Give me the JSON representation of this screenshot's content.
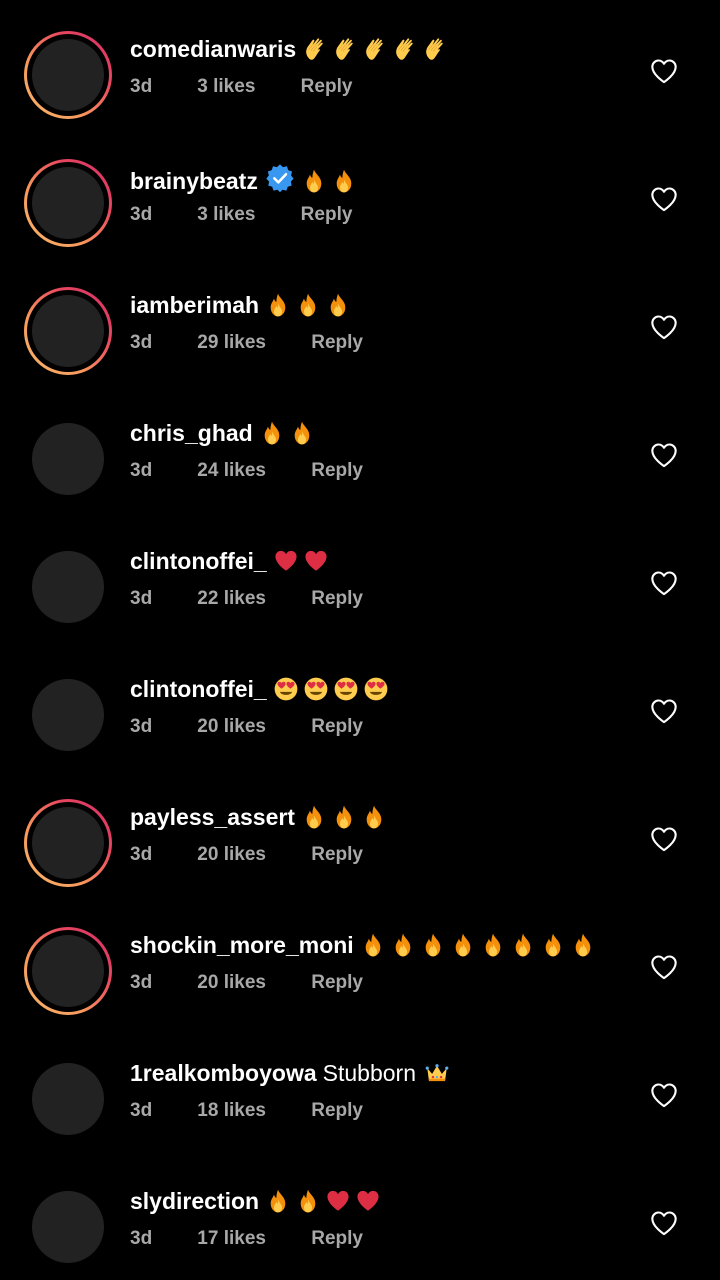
{
  "colors": {
    "background": "#000000",
    "meta_text": "#a8a8a8",
    "avatar_fill": "#222222",
    "verified_blue": "#3897f0",
    "story_ring": [
      "#f9b86a",
      "#e8475e",
      "#d42e6b"
    ]
  },
  "comments": [
    {
      "username": "comedianwaris",
      "verified": false,
      "story_ring": true,
      "text": "",
      "emojis": [
        "clap-emoji",
        "clap-emoji",
        "clap-emoji",
        "clap-emoji",
        "clap-emoji"
      ],
      "time": "3d",
      "likes": "3 likes",
      "reply": "Reply"
    },
    {
      "username": "brainybeatz",
      "verified": true,
      "story_ring": true,
      "text": "",
      "emojis": [
        "fire-emoji",
        "fire-emoji"
      ],
      "time": "3d",
      "likes": "3 likes",
      "reply": "Reply"
    },
    {
      "username": "iamberimah",
      "verified": false,
      "story_ring": true,
      "text": "",
      "emojis": [
        "fire-emoji",
        "fire-emoji",
        "fire-emoji"
      ],
      "time": "3d",
      "likes": "29 likes",
      "reply": "Reply"
    },
    {
      "username": "chris_ghad",
      "verified": false,
      "story_ring": false,
      "text": "",
      "emojis": [
        "fire-emoji",
        "fire-emoji"
      ],
      "time": "3d",
      "likes": "24 likes",
      "reply": "Reply"
    },
    {
      "username": "clintonoffei_",
      "verified": false,
      "story_ring": false,
      "text": "",
      "emojis": [
        "red-heart-emoji",
        "red-heart-emoji"
      ],
      "time": "3d",
      "likes": "22 likes",
      "reply": "Reply"
    },
    {
      "username": "clintonoffei_",
      "verified": false,
      "story_ring": false,
      "text": "",
      "emojis": [
        "heart-eyes-emoji",
        "heart-eyes-emoji",
        "heart-eyes-emoji",
        "heart-eyes-emoji"
      ],
      "time": "3d",
      "likes": "20 likes",
      "reply": "Reply"
    },
    {
      "username": "payless_assert",
      "verified": false,
      "story_ring": true,
      "text": "",
      "emojis": [
        "fire-emoji",
        "fire-emoji",
        "fire-emoji"
      ],
      "time": "3d",
      "likes": "20 likes",
      "reply": "Reply"
    },
    {
      "username": "shockin_more_moni",
      "verified": false,
      "story_ring": true,
      "text": "",
      "emojis": [
        "fire-emoji",
        "fire-emoji",
        "fire-emoji",
        "fire-emoji",
        "fire-emoji",
        "fire-emoji",
        "fire-emoji",
        "fire-emoji"
      ],
      "time": "3d",
      "likes": "20 likes",
      "reply": "Reply"
    },
    {
      "username": "1realkomboyowa",
      "verified": false,
      "story_ring": false,
      "text": "Stubborn",
      "emojis": [
        "crown-emoji"
      ],
      "time": "3d",
      "likes": "18 likes",
      "reply": "Reply"
    },
    {
      "username": "slydirection",
      "verified": false,
      "story_ring": false,
      "text": "",
      "emojis": [
        "fire-emoji",
        "fire-emoji",
        "red-heart-emoji",
        "red-heart-emoji"
      ],
      "time": "3d",
      "likes": "17 likes",
      "reply": "Reply"
    }
  ]
}
